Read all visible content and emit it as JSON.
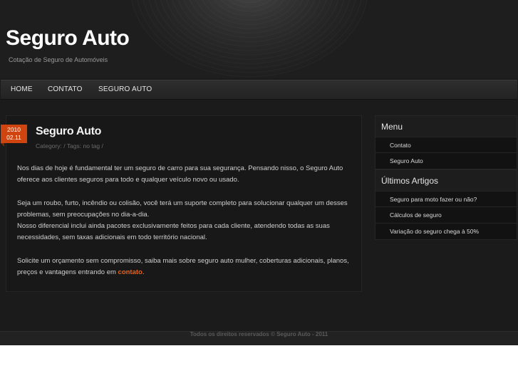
{
  "site": {
    "title": "Seguro Auto",
    "description": "Cotação de Seguro de Automóveis"
  },
  "nav": {
    "items": [
      {
        "label": "HOME"
      },
      {
        "label": "CONTATO"
      },
      {
        "label": "SEGURO AUTO"
      }
    ]
  },
  "post": {
    "date_year": "2010",
    "date_day": "02.11",
    "title": "Seguro Auto",
    "meta": "Category:  / Tags: no tag /",
    "paragraphs": [
      "Nos dias de hoje é fundamental ter um seguro de carro para sua segurança. Pensando nisso, o Seguro Auto oferece aos clientes seguros para todo e qualquer veículo novo ou usado.",
      "Seja um roubo, furto, incêndio ou colisão, você terá um suporte completo para solucionar qualquer um desses problemas, sem preocupações no dia-a-dia.",
      "Nosso diferencial inclui ainda pacotes exclusivamente feitos para cada cliente, atendendo todas as suas necessidades, sem taxas adicionais em todo território nacional.",
      "Solicite um orçamento sem compromisso, saiba mais sobre seguro auto mulher, coberturas adicionais, planos, preços e vantagens entrando em "
    ],
    "link_label": "contato",
    "link_suffix": "."
  },
  "sidebar": {
    "menu_title": "Menu",
    "menu_items": [
      {
        "label": "Contato"
      },
      {
        "label": "Seguro Auto"
      }
    ],
    "articles_title": "Últimos Artigos",
    "article_items": [
      {
        "label": "Seguro para moto fazer ou não?"
      },
      {
        "label": "Cálculos de seguro"
      },
      {
        "label": "Variação do seguro chega à 50%"
      }
    ]
  },
  "footer": {
    "text": "Todos os direitos reservados © Seguro Auto - 2011"
  },
  "colors": {
    "accent": "#d0450f",
    "link": "#e8631b",
    "background": "#1b1b1b"
  }
}
